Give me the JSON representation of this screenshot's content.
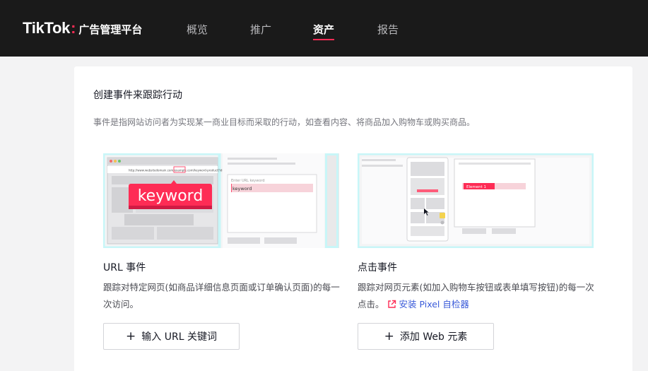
{
  "header": {
    "logo_brand": "TikTok",
    "logo_colon": ":",
    "logo_subtitle": "广告管理平台",
    "nav": [
      {
        "label": "概览",
        "active": false
      },
      {
        "label": "推广",
        "active": false
      },
      {
        "label": "资产",
        "active": true
      },
      {
        "label": "报告",
        "active": false
      }
    ]
  },
  "main": {
    "title": "创建事件来跟踪行动",
    "description": "事件是指网站访问者为实现某一商业目标而采取的行动，如查看内容、将商品加入购物车或购买商品。",
    "url_event": {
      "illustration": {
        "url_text": "http://www.websitedomain.com/example.com/keyword-product?id=1234",
        "keyword_badge": "keyword",
        "input_placeholder": "Enter URL keyword",
        "input_value": "keyword"
      },
      "title": "URL 事件",
      "description": "跟踪对特定网页(如商品详细信息页面或订单确认页面)的每一次访问。",
      "button_label": "输入 URL 关键词"
    },
    "click_event": {
      "illustration": {
        "element_tag": "Element 1"
      },
      "title": "点击事件",
      "description": "跟踪对网页元素(如加入购物车按钮或表单填写按钮)的每一次点击。",
      "link_label": "安装 Pixel 自检器",
      "button_label": "添加 Web 元素"
    }
  },
  "colors": {
    "topbar": "#1a1a1a",
    "accent": "#fe2c55",
    "link": "#3a5bd9",
    "highlight_cyan": "#c8f6f8"
  }
}
